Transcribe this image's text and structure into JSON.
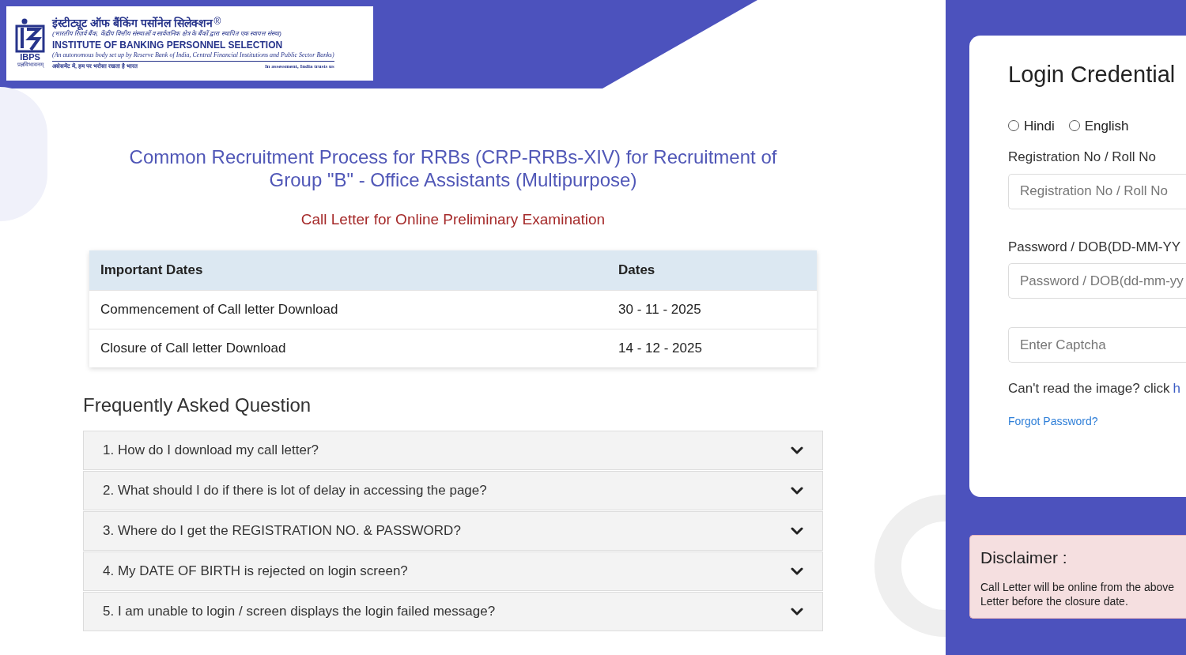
{
  "logo": {
    "hindi_name": "इंस्टीट्यूट ऑफ बैंकिंग पर्सोनेल सिलेक्शन",
    "registered_mark": "®",
    "hindi_subtitle": "(भारतीय रिज़र्व बैंक, केंद्रीय वित्तीय संस्थाओं व सार्वजनिक क्षेत्र के बैंकों द्वारा स्थापित एक स्वायत्त संस्था)",
    "english_name": "INSTITUTE OF BANKING PERSONNEL SELECTION",
    "english_subtitle": "(An autonomous body set up by Reserve Bank of India, Central Financial Institutions and Public Sector Banks)",
    "hindi_tagline": "असेसमेंट में, हम पर भरोसा रखता है भारत",
    "english_tagline": "In assessment, India trusts us",
    "acronym": "IBPS",
    "motto": "प्रज्ञविभावनम्"
  },
  "title": "Common Recruitment Process for RRBs (CRP-RRBs-XIV) for Recruitment of Group \"B\" - Office Assistants (Multipurpose)",
  "subtitle": "Call Letter for Online Preliminary Examination",
  "dates_table": {
    "columns": [
      "Important Dates",
      "Dates"
    ],
    "rows": [
      [
        "Commencement of Call letter Download",
        "30 - 11 - 2025"
      ],
      [
        "Closure of Call letter Download",
        "14 - 12 - 2025"
      ]
    ]
  },
  "faq": {
    "heading": "Frequently Asked Question",
    "items": [
      {
        "question": "1. How do I download my call letter?",
        "expanded": false
      },
      {
        "question": "2. What should I do if there is lot of delay in accessing the page?",
        "expanded": false
      },
      {
        "question": "3. Where do I get the REGISTRATION NO. & PASSWORD?",
        "expanded": false
      },
      {
        "question": "4. My DATE OF BIRTH is rejected on login screen?",
        "expanded": false
      },
      {
        "question": "5. I am unable to login / screen displays the login failed message?",
        "expanded": false
      }
    ]
  },
  "login": {
    "title": "Login Credential",
    "languages": [
      {
        "label": "Hindi",
        "selected": false
      },
      {
        "label": "English",
        "selected": false
      }
    ],
    "registration": {
      "label": "Registration No / Roll No",
      "placeholder": "Registration No / Roll No"
    },
    "password": {
      "label": "Password / DOB(DD-MM-YY",
      "placeholder": "Password / DOB(dd-mm-yy"
    },
    "captcha": {
      "placeholder": "Enter Captcha"
    },
    "captcha_help": "Can't read the image? click",
    "captcha_link": "h",
    "forgot": "Forgot Password?"
  },
  "disclaimer": {
    "title": "Disclaimer :",
    "lines": [
      "Call Letter will be online from the above",
      "Letter before the closure date."
    ]
  }
}
